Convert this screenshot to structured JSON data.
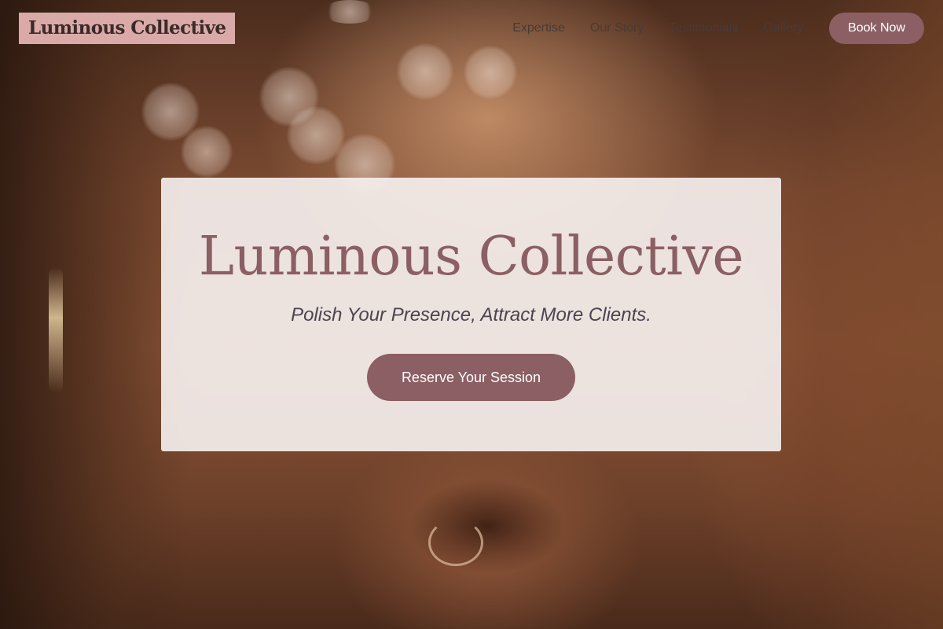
{
  "header": {
    "logo_text": "Luminous Collective",
    "nav": [
      {
        "label": "Expertise"
      },
      {
        "label": "Our Story"
      },
      {
        "label": "Testimonials"
      },
      {
        "label": "Gallery"
      }
    ],
    "book_label": "Book Now"
  },
  "hero": {
    "title": "Luminous Collective",
    "tagline": "Polish Your Presence, Attract More Clients.",
    "cta_label": "Reserve Your Session"
  },
  "colors": {
    "accent": "#8b5f63",
    "logo_background": "#d9aaa7",
    "card_background": "#f7f2f1"
  }
}
